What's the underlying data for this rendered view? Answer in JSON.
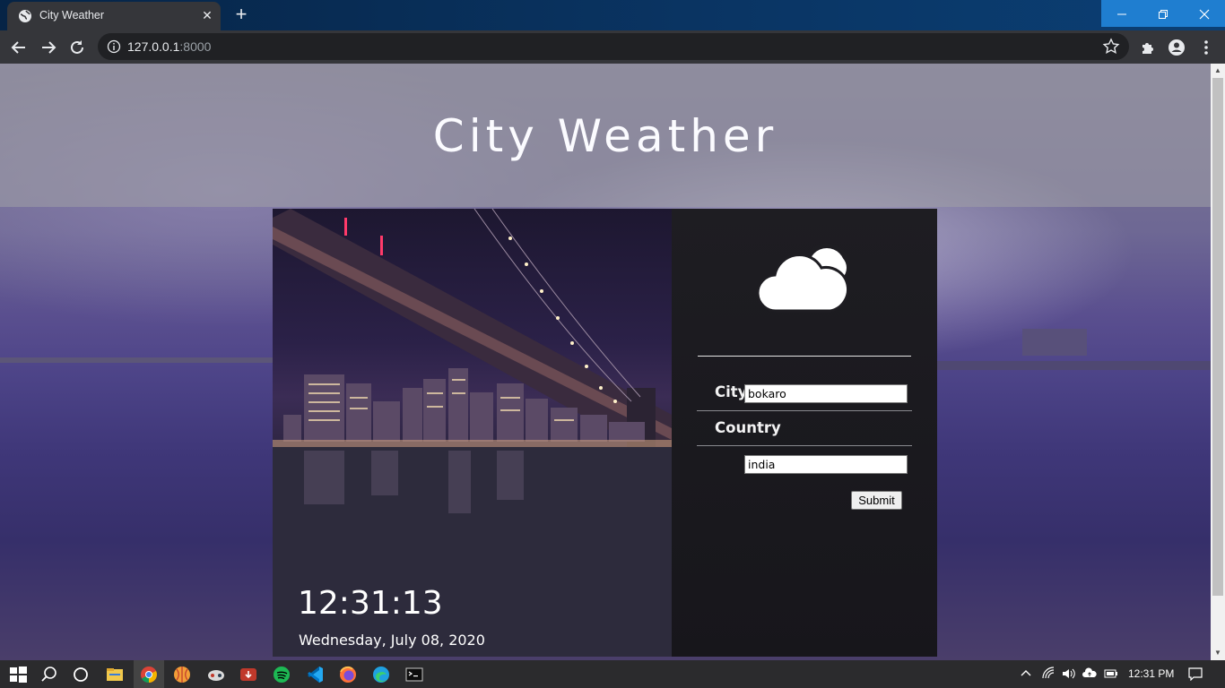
{
  "browser": {
    "tab_title": "City Weather",
    "url_host": "127.0.0.1",
    "url_port": ":8000",
    "new_tab_symbol": "+",
    "close_symbol": "✕"
  },
  "page": {
    "heading": "City Weather",
    "clock": "12:31:13",
    "date": "Wednesday, July 08, 2020",
    "form": {
      "city_label": "City",
      "city_value": "bokaro",
      "country_label": "Country",
      "country_value": "india",
      "submit_label": "Submit"
    },
    "weather_icon": "cloud-partly-icon"
  },
  "taskbar": {
    "time": "12:31 PM",
    "icons": [
      "windows-start-icon",
      "search-icon",
      "cortana-icon",
      "file-explorer-icon",
      "chrome-icon",
      "app-orange-icon",
      "app-game-icon",
      "app-download-icon",
      "spotify-icon",
      "vscode-icon",
      "firefox-icon",
      "edge-icon",
      "terminal-icon"
    ]
  },
  "colors": {
    "accent_window_controls": "#1f7ed0",
    "panel_bg": "#1e1d22",
    "heading_color": "#fbfbff"
  }
}
